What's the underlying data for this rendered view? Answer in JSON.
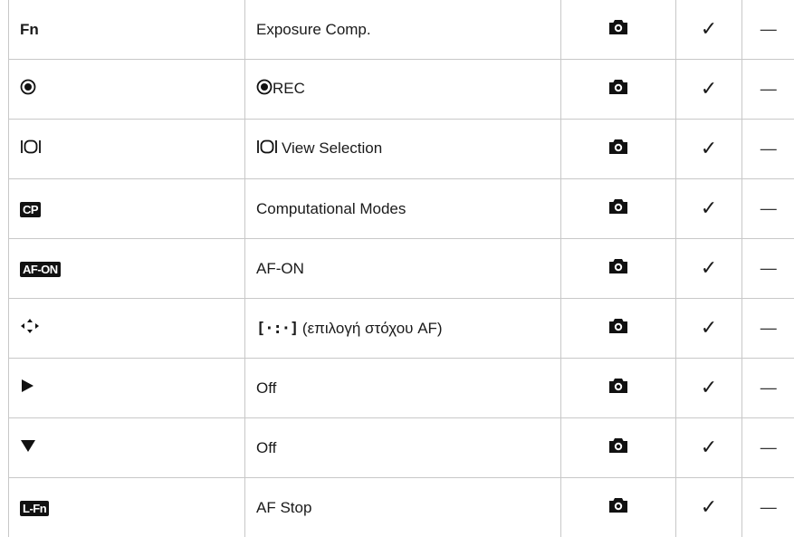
{
  "rows": [
    {
      "button": "Fn",
      "button_icon": "fn-label",
      "function": "Exposure Comp.",
      "function_icon": null,
      "mode_icon": "camera-icon",
      "check": "✓",
      "dash": "—"
    },
    {
      "button": null,
      "button_icon": "rec-button-icon",
      "function": "REC",
      "function_icon": "rec-icon",
      "mode_icon": "camera-icon",
      "check": "✓",
      "dash": "—"
    },
    {
      "button": null,
      "button_icon": "view-selection-icon",
      "function": "View Selection",
      "function_icon": "view-selection-icon",
      "mode_icon": "camera-icon",
      "check": "✓",
      "dash": "—"
    },
    {
      "button": "CP",
      "button_icon": "cp-badge",
      "function": "Computational Modes",
      "function_icon": null,
      "mode_icon": "camera-icon",
      "check": "✓",
      "dash": "—"
    },
    {
      "button": "AF-ON",
      "button_icon": "af-on-badge",
      "function": "AF-ON",
      "function_icon": null,
      "mode_icon": "camera-icon",
      "check": "✓",
      "dash": "—"
    },
    {
      "button": null,
      "button_icon": "multi-selector-icon",
      "function": "(επιλογή στόχου AF)",
      "function_icon": "af-target-frame-icon",
      "function_icon_text": "[·:·]",
      "mode_icon": "camera-icon",
      "check": "✓",
      "dash": "—"
    },
    {
      "button": null,
      "button_icon": "arrow-right-icon",
      "function": "Off",
      "function_icon": null,
      "mode_icon": "camera-icon",
      "check": "✓",
      "dash": "—"
    },
    {
      "button": null,
      "button_icon": "arrow-down-icon",
      "function": "Off",
      "function_icon": null,
      "mode_icon": "camera-icon",
      "check": "✓",
      "dash": "—"
    },
    {
      "button": "L-Fn",
      "button_icon": "lfn-badge",
      "function": "AF Stop",
      "function_icon": null,
      "mode_icon": "camera-icon",
      "check": "✓",
      "dash": "—"
    }
  ]
}
